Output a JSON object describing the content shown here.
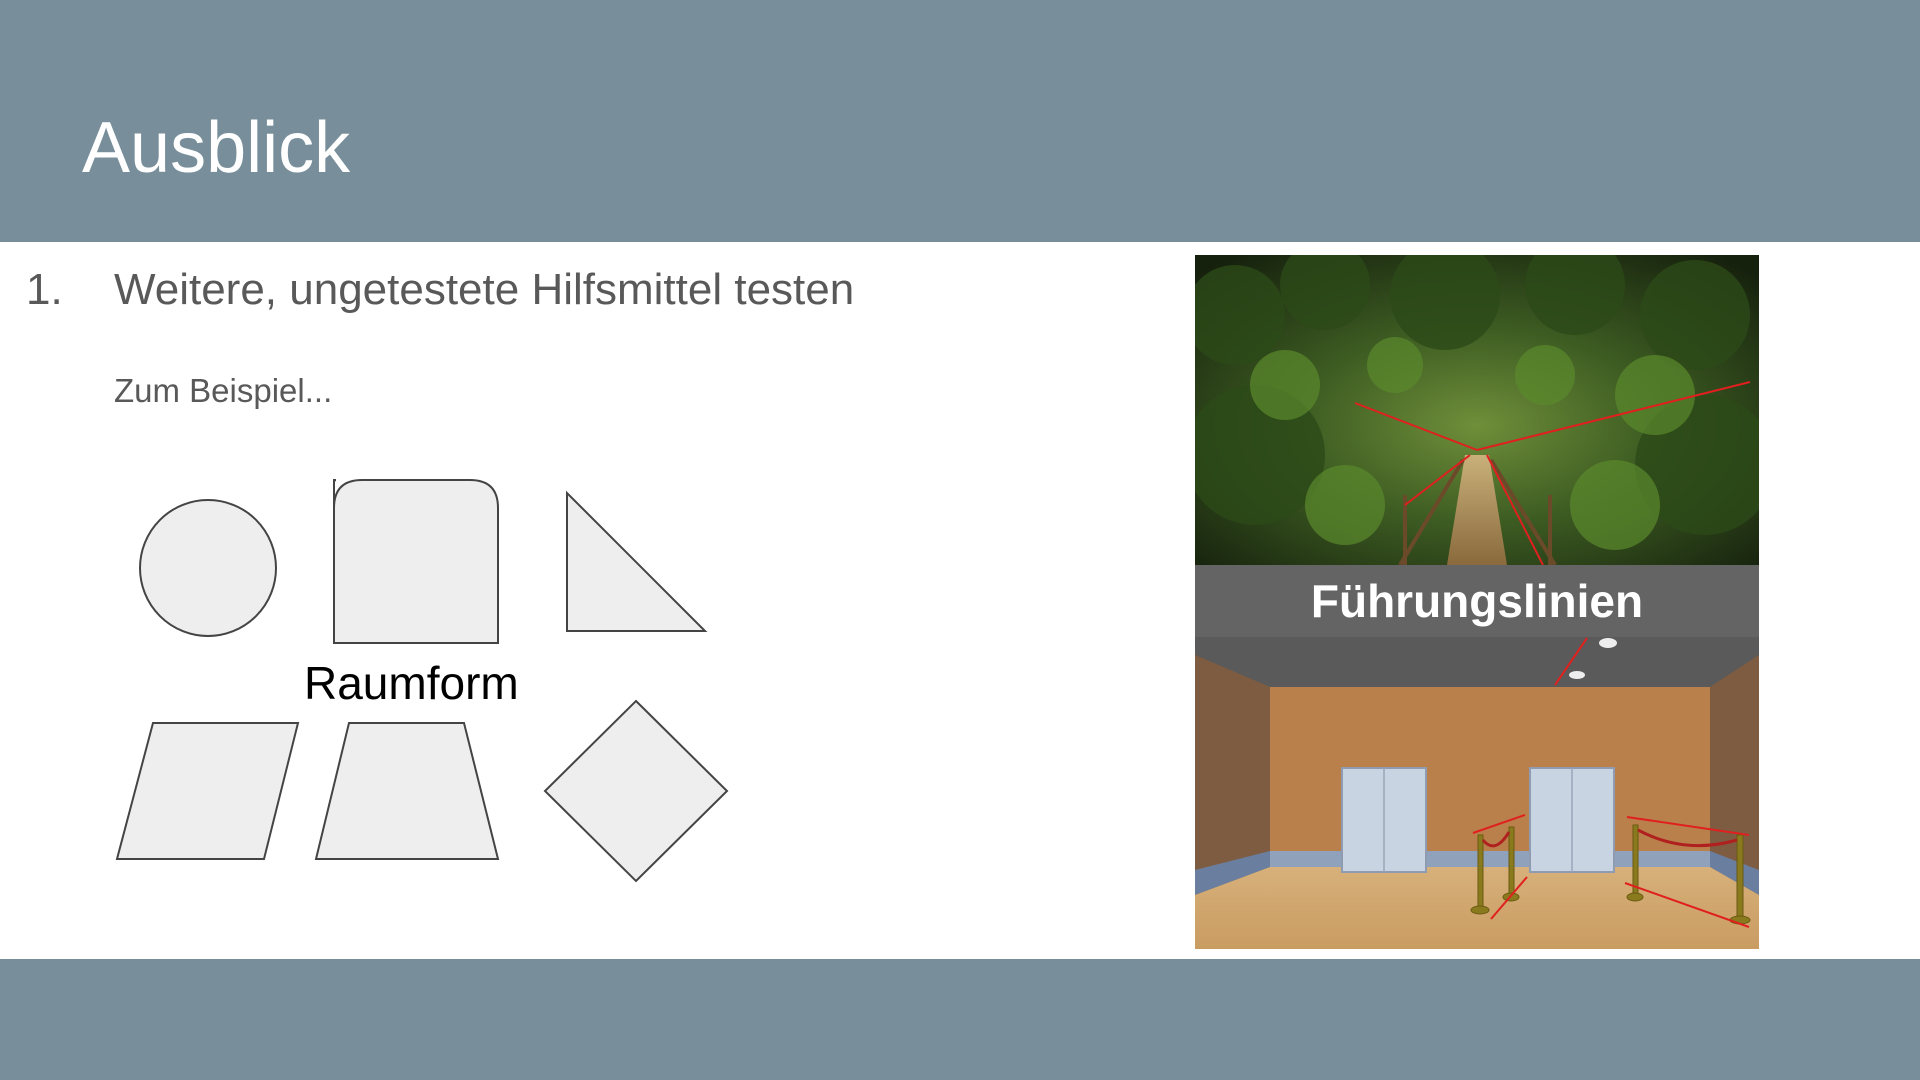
{
  "slide": {
    "title": "Ausblick",
    "list_number": "1.",
    "list_text": "Weitere, ungetestete Hilfsmittel testen",
    "sub_text": "Zum Beispiel...",
    "shapes_label": "Raumform",
    "image_banner": "Führungslinien"
  },
  "colors": {
    "band": "#788f9b",
    "text_gray": "#595959",
    "shape_fill": "#eeeeee",
    "shape_stroke": "#444444",
    "guide_line": "#e0201f",
    "banner_bg": "#646464"
  },
  "icons": [
    "circle-shape",
    "rounded-square-shape",
    "triangle-shape",
    "parallelogram-shape",
    "trapezoid-shape",
    "diamond-shape"
  ]
}
